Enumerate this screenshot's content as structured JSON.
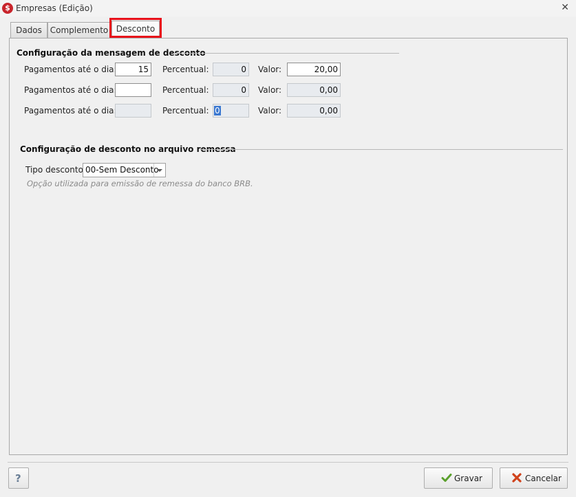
{
  "window": {
    "title": "Empresas (Edição)",
    "app_icon": "$",
    "close_glyph": "✕"
  },
  "tabs": [
    {
      "label": "Dados",
      "active": false
    },
    {
      "label": "Complemento",
      "active": false
    },
    {
      "label": "Desconto",
      "active": true
    }
  ],
  "highlight_color": "#e8101a",
  "discount_message": {
    "title": "Configuração da mensagem de desconto",
    "rows": [
      {
        "day_label": "Pagamentos até o dia:",
        "day_value": "15",
        "percent_label": "Percentual:",
        "percent_value": "0",
        "value_label": "Valor:",
        "value_value": "20,00"
      },
      {
        "day_label": "Pagamentos até o dia:",
        "day_value": "",
        "percent_label": "Percentual:",
        "percent_value": "0",
        "value_label": "Valor:",
        "value_value": "0,00"
      },
      {
        "day_label": "Pagamentos até o dia:",
        "day_value": "",
        "percent_label": "Percentual:",
        "percent_value": "0",
        "value_label": "Valor:",
        "value_value": "0,00"
      }
    ]
  },
  "remessa": {
    "title": "Configuração de desconto no arquivo remessa",
    "type_label": "Tipo desconto:",
    "type_value": "00-Sem Desconto",
    "hint": "Opção utilizada para emissão de remessa do banco BRB."
  },
  "footer": {
    "help_label": "?",
    "save_label": "Gravar",
    "save_icon": "check-icon",
    "cancel_label": "Cancelar",
    "cancel_icon": "cancel-x-icon"
  }
}
